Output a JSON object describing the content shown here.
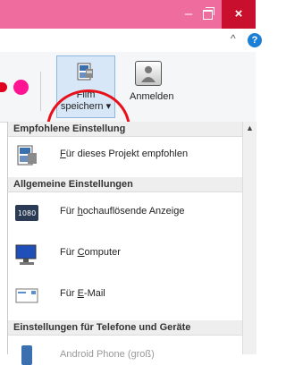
{
  "titlebar": {
    "minimize": "–",
    "close": "×"
  },
  "ribbon": {
    "collapse_caret": "^",
    "help_label": "?",
    "film_button": {
      "line1": "Film",
      "line2": "speichern",
      "dropdown_caret": "▾"
    },
    "anmelden_button": {
      "label": "Anmelden"
    }
  },
  "menu": {
    "sections": [
      {
        "header": "Empfohlene Einstellung",
        "items": [
          {
            "prefix": "",
            "accel": "F",
            "rest": "ür dieses Projekt empfohlen",
            "icon": "project-film-icon"
          }
        ]
      },
      {
        "header": "Allgemeine Einstellungen",
        "items": [
          {
            "prefix": "Für ",
            "accel": "h",
            "rest": "ochauflösende Anzeige",
            "icon": "hd-1080-icon",
            "badge": "1080"
          },
          {
            "prefix": "Für ",
            "accel": "C",
            "rest": "omputer",
            "icon": "computer-icon"
          },
          {
            "prefix": "Für ",
            "accel": "E",
            "rest": "-Mail",
            "icon": "email-icon"
          }
        ]
      },
      {
        "header": "Einstellungen für Telefone und Geräte",
        "items": [
          {
            "prefix": "",
            "accel": "",
            "rest": "Android Phone (groß)",
            "icon": "android-phone-icon"
          }
        ]
      }
    ]
  },
  "colors": {
    "titlebar": "#ee6d9e",
    "close_button": "#c8102e",
    "highlight_circle": "#e8101a",
    "selected_button": "#d7e7f7"
  }
}
